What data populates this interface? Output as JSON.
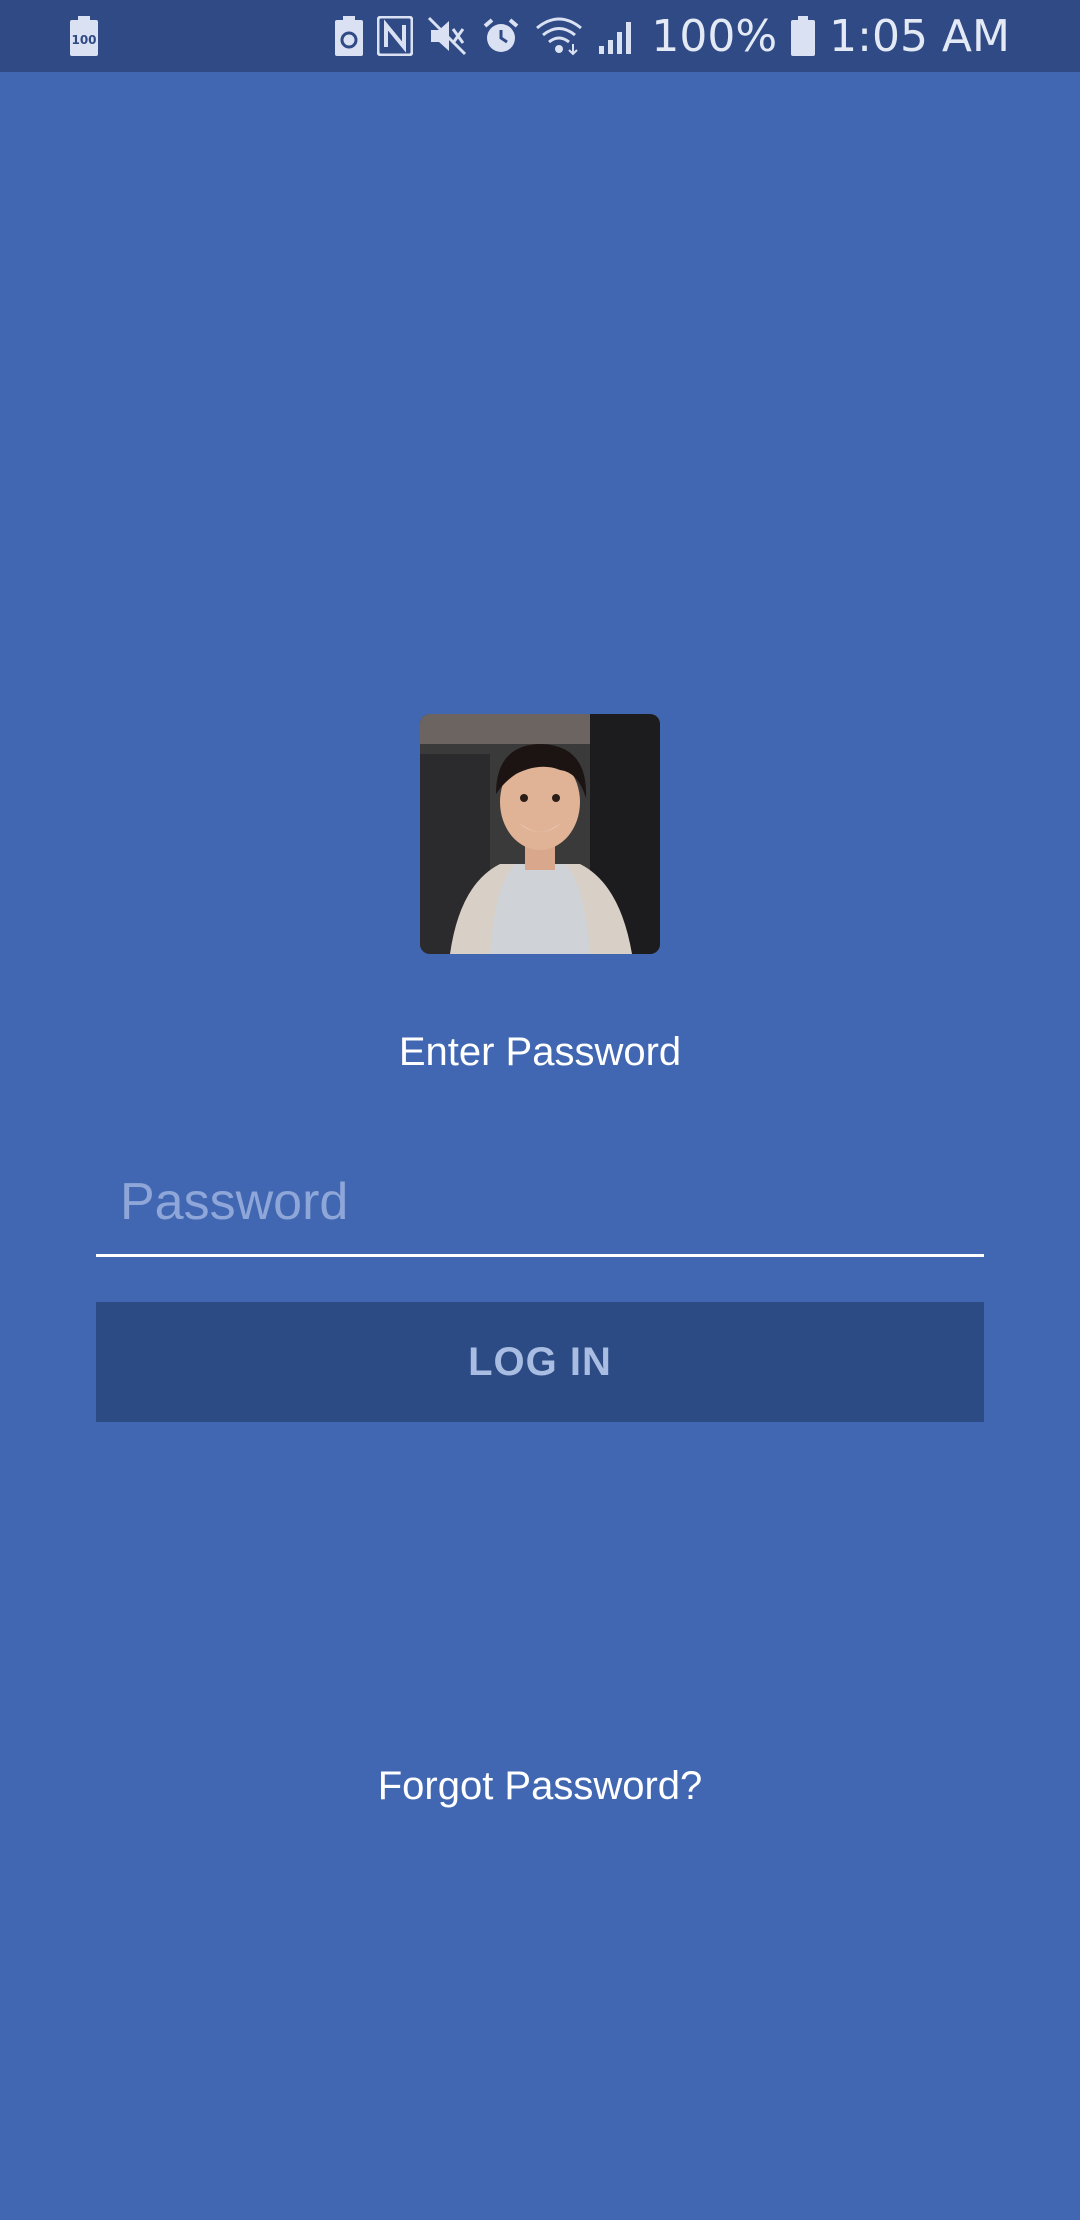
{
  "status_bar": {
    "battery_icon_text": "100",
    "battery_percent": "100%",
    "time": "1:05 AM",
    "icons": [
      "battery-saver-icon",
      "nfc-icon",
      "mute-icon",
      "alarm-icon",
      "wifi-icon",
      "signal-icon",
      "battery-icon"
    ]
  },
  "login": {
    "avatar_icon": "profile-photo",
    "prompt": "Enter Password",
    "password_placeholder": "Password",
    "login_button": "LOG IN",
    "forgot_link": "Forgot Password?"
  },
  "colors": {
    "background": "#4267b2",
    "status_bar": "#2f4a85",
    "button": "#2c4a84",
    "button_text": "#a9bde2",
    "placeholder": "#8ea6d8"
  }
}
